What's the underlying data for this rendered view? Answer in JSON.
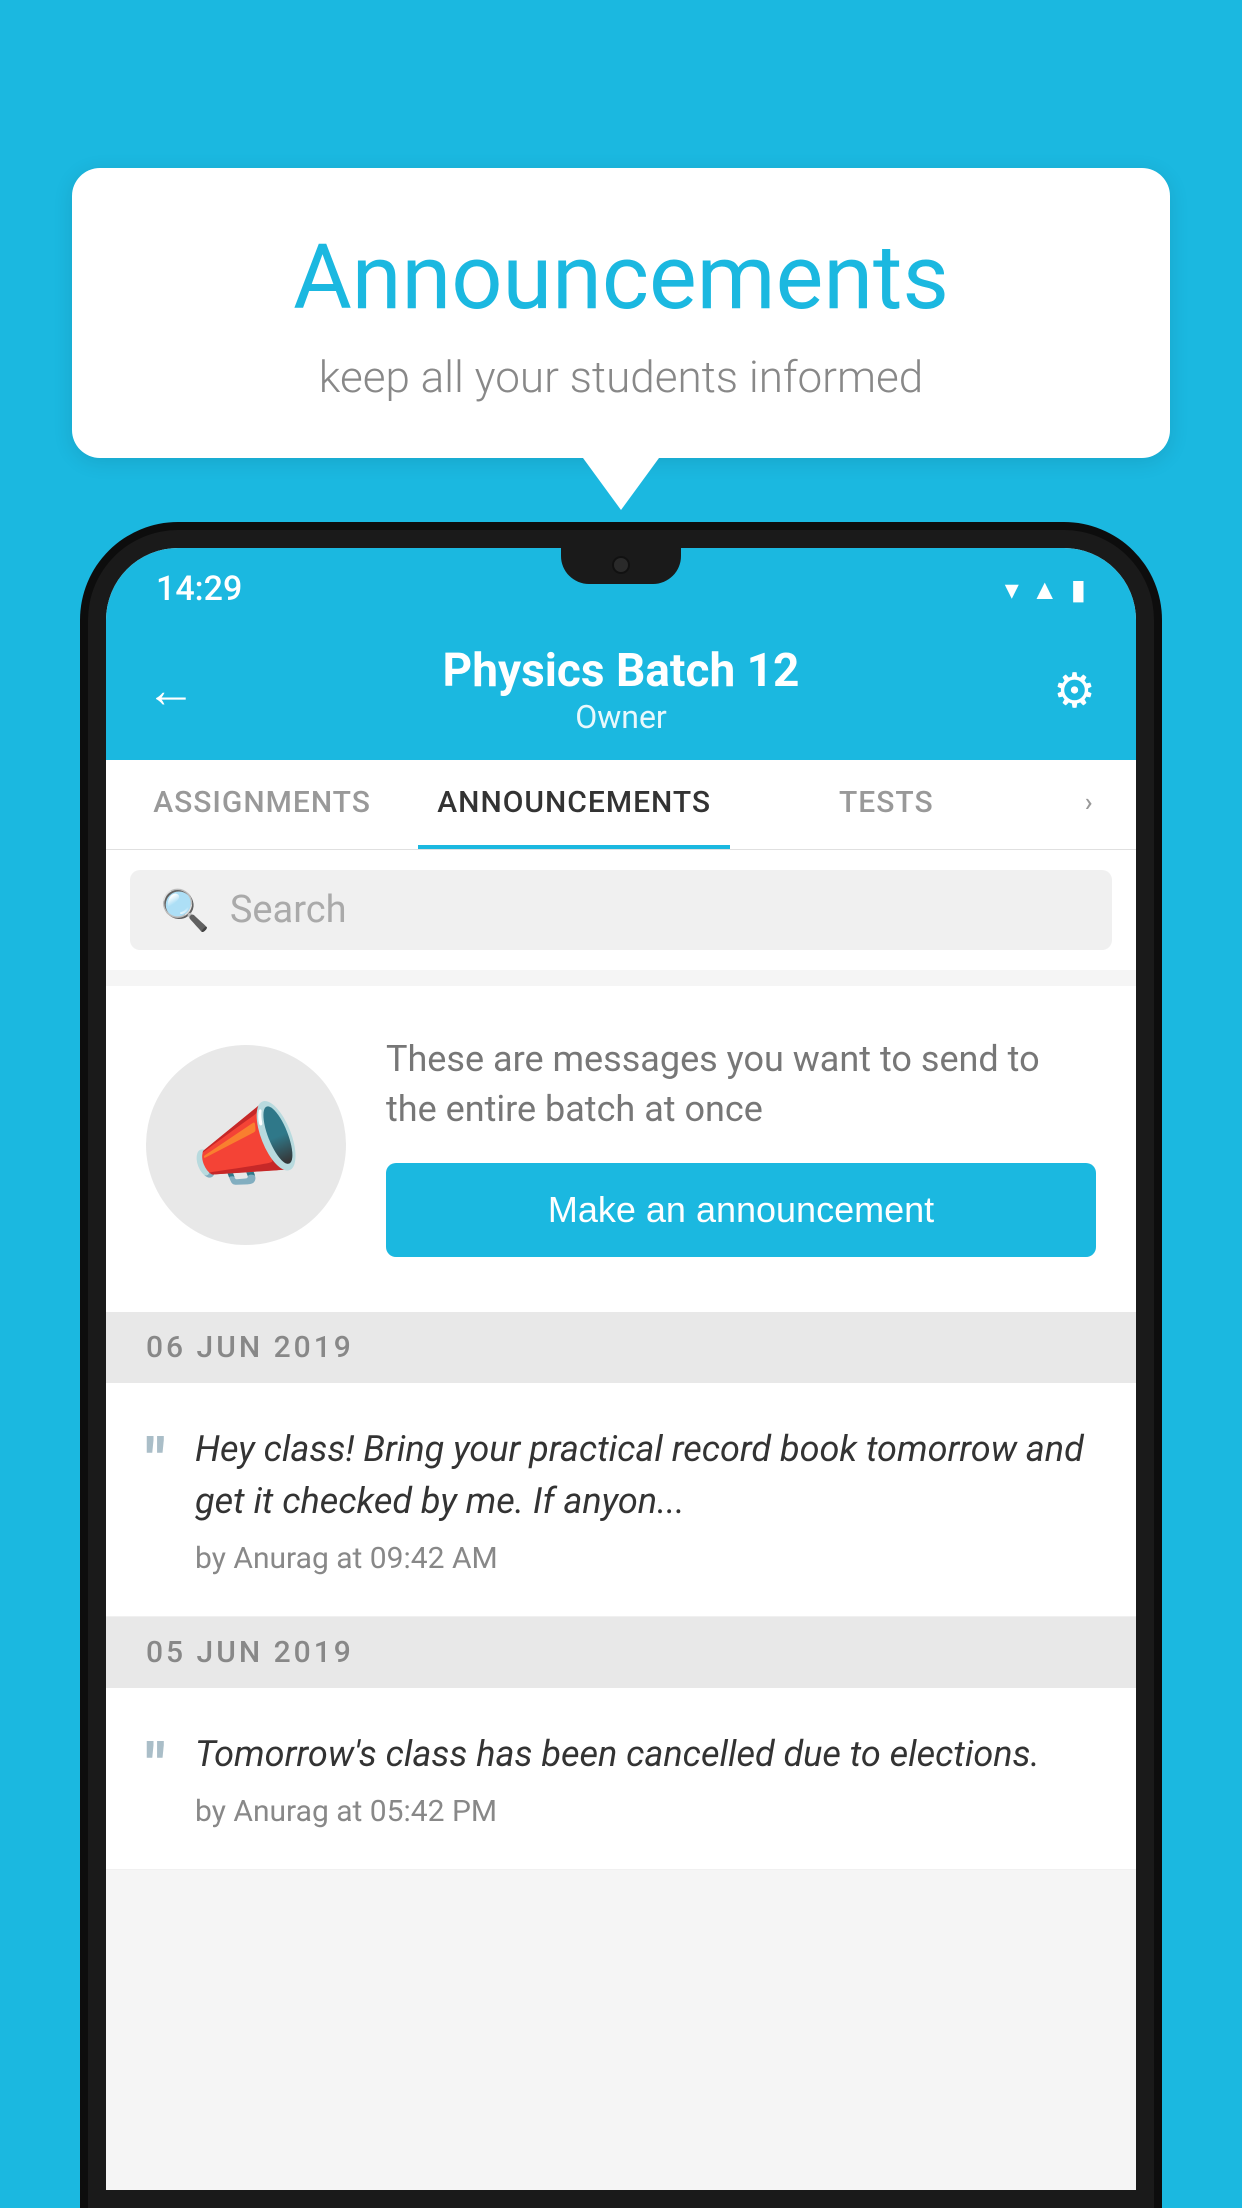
{
  "background_color": "#1bb8e0",
  "bubble": {
    "title": "Announcements",
    "subtitle": "keep all your students informed"
  },
  "status_bar": {
    "time": "14:29",
    "icons": [
      "wifi",
      "signal",
      "battery"
    ]
  },
  "app_bar": {
    "back_label": "←",
    "title": "Physics Batch 12",
    "subtitle": "Owner",
    "settings_label": "⚙"
  },
  "tabs": [
    {
      "label": "ASSIGNMENTS",
      "active": false
    },
    {
      "label": "ANNOUNCEMENTS",
      "active": true
    },
    {
      "label": "TESTS",
      "active": false
    },
    {
      "label": "...",
      "active": false
    }
  ],
  "search": {
    "placeholder": "Search"
  },
  "announcement_prompt": {
    "description": "These are messages you want to send to the entire batch at once",
    "button_label": "Make an announcement"
  },
  "messages": [
    {
      "date": "06  JUN  2019",
      "text": "Hey class! Bring your practical record book tomorrow and get it checked by me. If anyon...",
      "meta": "by Anurag at 09:42 AM"
    },
    {
      "date": "05  JUN  2019",
      "text": "Tomorrow's class has been cancelled due to elections.",
      "meta": "by Anurag at 05:42 PM"
    }
  ]
}
